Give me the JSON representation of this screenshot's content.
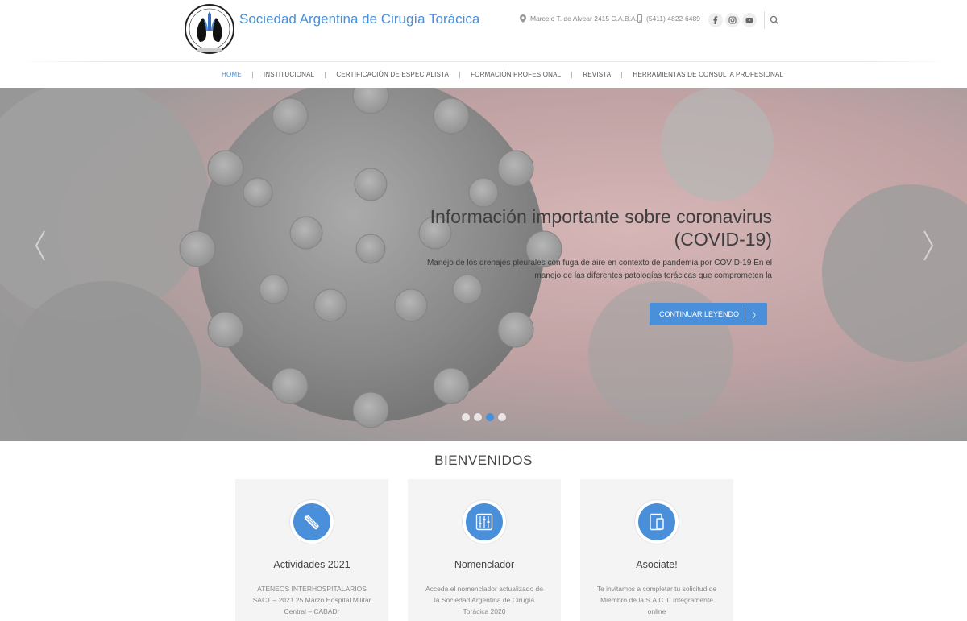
{
  "header": {
    "site_title": "Sociedad Argentina de Cirugía Torácica",
    "logo_text": "SOCIEDAD ARGENTINA DE CIRUGÍA TORÁCICA",
    "address": "Marcelo T. de Alvear 2415 C.A.B.A.",
    "phone": "(5411) 4822-6489",
    "social": [
      "facebook-icon",
      "instagram-icon",
      "youtube-icon"
    ],
    "search_icon": "search-icon"
  },
  "nav": {
    "items": [
      {
        "label": "HOME",
        "active": true
      },
      {
        "label": "INSTITUCIONAL"
      },
      {
        "label": "CERTIFICACIÓN DE ESPECIALISTA"
      },
      {
        "label": "FORMACIÓN PROFESIONAL"
      },
      {
        "label": "REVISTA"
      },
      {
        "label": "HERRAMIENTAS DE CONSULTA PROFESIONAL"
      }
    ]
  },
  "slider": {
    "title": "Información importante sobre coronavirus (COVID-19)",
    "text": "Manejo de los drenajes pleurales con fuga de aire en contexto de pandemia por COVID-19 En el manejo de las diferentes patologías torácicas que comprometen la",
    "button_label": "CONTINUAR LEYENDO",
    "button_chevron": "〉",
    "active_slide": 3,
    "slide_count": 4
  },
  "welcome": {
    "title": "BIENVENIDOS",
    "cards": [
      {
        "title": "Actividades 2021",
        "text": "ATENEOS INTERHOSPITALARIOS SACT – 2021 25 Marzo Hospital Militar Central – CABADr",
        "icon": "pencil-ruler-icon"
      },
      {
        "title": "Nomenclador",
        "text": "Acceda el nomenclador actualizado de la Sociedad Argentina de Cirugía Torácica 2020",
        "icon": "sliders-icon"
      },
      {
        "title": "Asociate!",
        "text": "Te invitamos a completar tu solicitud de Miembro de la S.A.C.T. íntegramente online",
        "icon": "tablet-icon"
      }
    ]
  },
  "colors": {
    "accent": "#4a8fd9",
    "card_bg": "#f4f4f4"
  }
}
